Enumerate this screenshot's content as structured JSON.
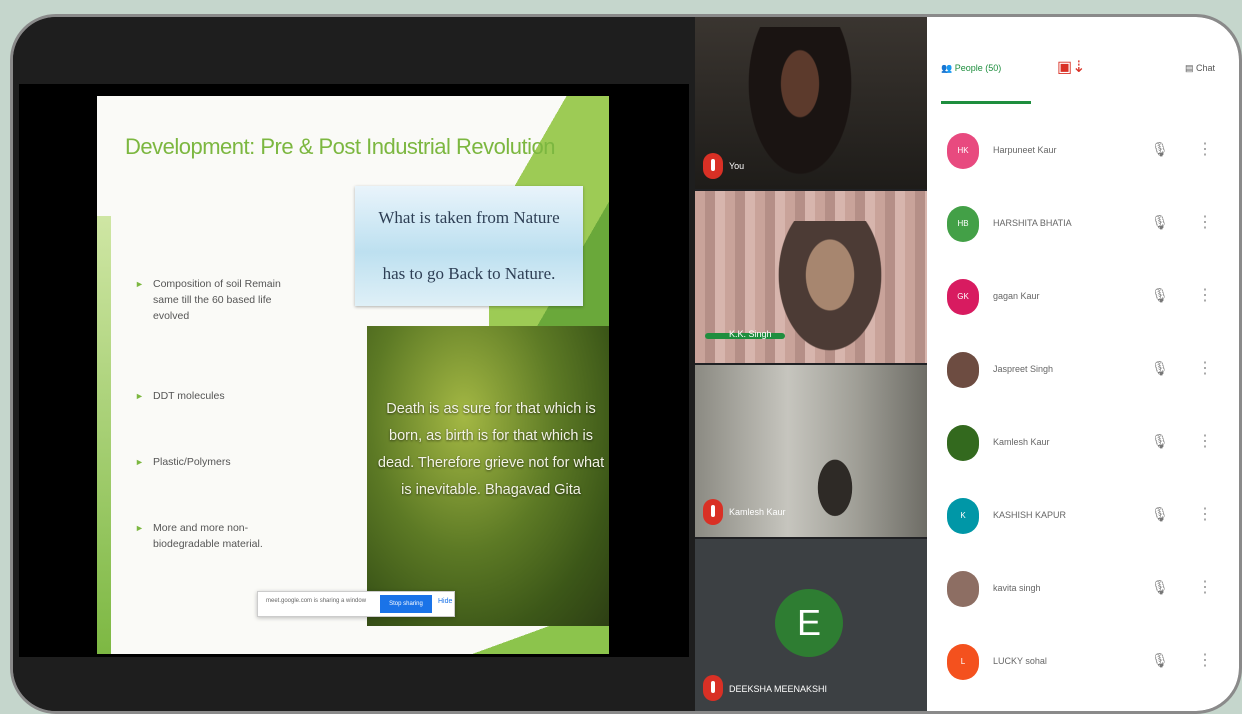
{
  "slide": {
    "title": "Development: Pre & Post Industrial Revolution",
    "quote_line1": "What is taken from Nature",
    "quote_line2": "has to go Back to Nature.",
    "photo_text": "Death is as sure for that which is born, as birth is for that which is dead. Therefore grieve not for what is inevitable. Bhagavad Gita",
    "bullets": [
      "Composition of soil Remain same till the 60 based life evolved",
      "DDT molecules",
      "Plastic/Polymers",
      "More and more non-biodegradable material."
    ],
    "share_text": "meet.google.com is sharing a window",
    "share_button": "Stop sharing",
    "share_hide": "Hide"
  },
  "tiles": [
    {
      "name": "You"
    },
    {
      "name": "K.K. Singh"
    },
    {
      "name": "Kamlesh Kaur"
    },
    {
      "name": "DEEKSHA MEENAKSHI",
      "initial": "E"
    }
  ],
  "panel": {
    "tab_people": "People (50)",
    "tab_chat": "Chat",
    "participants": [
      {
        "name": "Harpuneet Kaur",
        "initials": "HK",
        "color": "#e84a7f"
      },
      {
        "name": "HARSHITA BHATIA",
        "initials": "HB",
        "color": "#43a047"
      },
      {
        "name": "gagan Kaur",
        "initials": "GK",
        "color": "#d81b60"
      },
      {
        "name": "Jaspreet Singh",
        "initials": "",
        "color": "#6d4c41"
      },
      {
        "name": "Kamlesh Kaur",
        "initials": "",
        "color": "#33691e"
      },
      {
        "name": "KASHISH KAPUR",
        "initials": "K",
        "color": "#0097a7"
      },
      {
        "name": "kavita singh",
        "initials": "",
        "color": "#8d6e63"
      },
      {
        "name": "LUCKY sohal",
        "initials": "L",
        "color": "#f4511e"
      }
    ]
  }
}
